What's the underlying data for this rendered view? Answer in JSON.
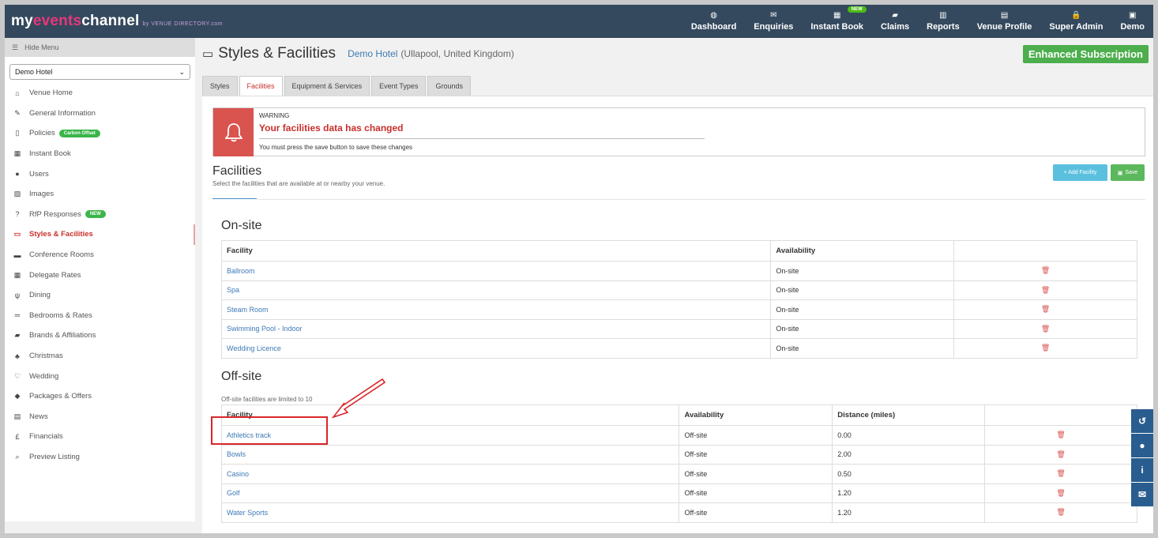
{
  "header": {
    "logo_my": "my",
    "logo_events": "events",
    "logo_channel": "channel",
    "logo_by": "by VENUE DIRECTORY.com",
    "nav": [
      {
        "label": "Dashboard",
        "icon": "dashboard-icon",
        "glyph": "◍"
      },
      {
        "label": "Enquiries",
        "icon": "envelope-icon",
        "glyph": "✉"
      },
      {
        "label": "Instant Book",
        "icon": "calendar-icon",
        "glyph": "▦",
        "badge": "NEW"
      },
      {
        "label": "Claims",
        "icon": "book-icon",
        "glyph": "▰"
      },
      {
        "label": "Reports",
        "icon": "bar-chart-icon",
        "glyph": "▥"
      },
      {
        "label": "Venue Profile",
        "icon": "building-icon",
        "glyph": "▤"
      },
      {
        "label": "Super Admin",
        "icon": "lock-icon",
        "glyph": "🔒"
      },
      {
        "label": "Demo",
        "icon": "user-square-icon",
        "glyph": "▣"
      }
    ]
  },
  "sidebar": {
    "hide_menu": "Hide Menu",
    "venue_select": "Demo Hotel",
    "items": [
      {
        "label": "Venue Home",
        "icon": "home-icon",
        "glyph": "⌂"
      },
      {
        "label": "General Information",
        "icon": "edit-icon",
        "glyph": "✎"
      },
      {
        "label": "Policies",
        "icon": "document-icon",
        "glyph": "▯",
        "pill": "Carbon Offset"
      },
      {
        "label": "Instant Book",
        "icon": "calendar-icon",
        "glyph": "▦"
      },
      {
        "label": "Users",
        "icon": "user-icon",
        "glyph": "●"
      },
      {
        "label": "Images",
        "icon": "image-icon",
        "glyph": "▨"
      },
      {
        "label": "RfP Responses",
        "icon": "question-icon",
        "glyph": "?",
        "pill": "NEW"
      },
      {
        "label": "Styles & Facilities",
        "icon": "monitor-icon",
        "glyph": "▭",
        "active": true
      },
      {
        "label": "Conference Rooms",
        "icon": "briefcase-icon",
        "glyph": "▬"
      },
      {
        "label": "Delegate Rates",
        "icon": "calculator-icon",
        "glyph": "▦"
      },
      {
        "label": "Dining",
        "icon": "cutlery-icon",
        "glyph": "ψ"
      },
      {
        "label": "Bedrooms & Rates",
        "icon": "bed-icon",
        "glyph": "═"
      },
      {
        "label": "Brands & Affiliations",
        "icon": "book-icon",
        "glyph": "▰"
      },
      {
        "label": "Christmas",
        "icon": "tree-icon",
        "glyph": "♣"
      },
      {
        "label": "Wedding",
        "icon": "heart-icon",
        "glyph": "♡"
      },
      {
        "label": "Packages & Offers",
        "icon": "tag-icon",
        "glyph": "◆"
      },
      {
        "label": "News",
        "icon": "newspaper-icon",
        "glyph": "▤"
      },
      {
        "label": "Financials",
        "icon": "pound-icon",
        "glyph": "£"
      },
      {
        "label": "Preview Listing",
        "icon": "search-icon",
        "glyph": "⌕"
      }
    ]
  },
  "page": {
    "title": "Styles & Facilities",
    "venue": "Demo Hotel",
    "location": "(Ullapool, United Kingdom)",
    "subscription": "Enhanced Subscription"
  },
  "tabs": [
    {
      "label": "Styles"
    },
    {
      "label": "Facilities",
      "active": true
    },
    {
      "label": "Equipment & Services"
    },
    {
      "label": "Event Types"
    },
    {
      "label": "Grounds"
    }
  ],
  "warning": {
    "label": "WARNING",
    "title": "Your facilities data has changed",
    "message": "You must press the save button to save these changes"
  },
  "facilities": {
    "title": "Facilities",
    "subtitle": "Select the facilities that are available at or nearby your venue.",
    "add_button": "+ Add Facility",
    "save_button": "Save"
  },
  "onsite": {
    "title": "On-site",
    "headers": [
      "Facility",
      "Availability",
      ""
    ],
    "rows": [
      {
        "facility": "Ballroom",
        "availability": "On-site"
      },
      {
        "facility": "Spa",
        "availability": "On-site"
      },
      {
        "facility": "Steam Room",
        "availability": "On-site"
      },
      {
        "facility": "Swimming Pool - Indoor",
        "availability": "On-site"
      },
      {
        "facility": "Wedding Licence",
        "availability": "On-site"
      }
    ]
  },
  "offsite": {
    "title": "Off-site",
    "note": "Off-site facilities are limited to 10",
    "headers": [
      "Facility",
      "Availability",
      "Distance (miles)",
      ""
    ],
    "rows": [
      {
        "facility": "Athletics track",
        "availability": "Off-site",
        "distance": "0.00"
      },
      {
        "facility": "Bowls",
        "availability": "Off-site",
        "distance": "2.00"
      },
      {
        "facility": "Casino",
        "availability": "Off-site",
        "distance": "0.50"
      },
      {
        "facility": "Golf",
        "availability": "Off-site",
        "distance": "1.20"
      },
      {
        "facility": "Water Sports",
        "availability": "Off-site",
        "distance": "1.20"
      }
    ]
  },
  "side_tools": [
    {
      "icon": "history-icon",
      "glyph": "↺"
    },
    {
      "icon": "chat-icon",
      "glyph": "●"
    },
    {
      "icon": "info-icon",
      "glyph": "i"
    },
    {
      "icon": "envelope-icon",
      "glyph": "✉"
    }
  ],
  "colors": {
    "topbar": "#34495e",
    "accent_red": "#d9534f",
    "link_blue": "#3d7ab5",
    "success_green": "#5cb85c",
    "info_blue": "#5bc0de",
    "annotation_red": "#d9262a"
  }
}
